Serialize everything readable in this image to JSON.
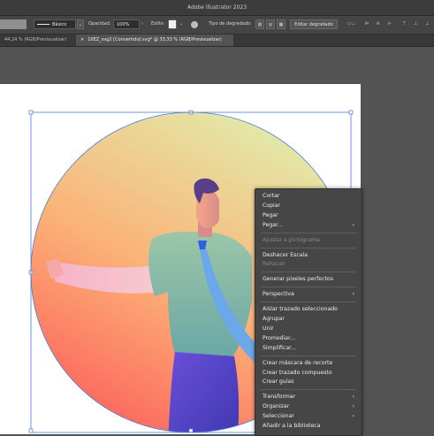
{
  "app": {
    "title": "Adobe Illustrator 2023"
  },
  "control_bar": {
    "stroke_style": "Básico",
    "opacity_label": "Opacidad:",
    "opacity_value": "100%",
    "style_label": "Estilo:",
    "gradient_type_label": "Tipo de degradado:",
    "edit_gradient_button": "Editar degradado"
  },
  "tabs": [
    {
      "label": "44,24 % (RGB/Previsualizar)"
    },
    {
      "label": "10EZ_svg2 [Convertido].svg* @ 33,33 % (RGB/Previsualizar)"
    }
  ],
  "colors": {
    "selection": "#4a7bd8",
    "menu_bg": "#464646",
    "canvas_bg": "#535353"
  },
  "context_menu": {
    "groups": [
      [
        {
          "label": "Cortar",
          "enabled": true,
          "submenu": false
        },
        {
          "label": "Copiar",
          "enabled": true,
          "submenu": false
        },
        {
          "label": "Pegar",
          "enabled": true,
          "submenu": false
        },
        {
          "label": "Pegar...",
          "enabled": true,
          "submenu": true
        }
      ],
      [
        {
          "label": "Ajustar a pictograma",
          "enabled": false,
          "submenu": false
        }
      ],
      [
        {
          "label": "Deshacer Escala",
          "enabled": true,
          "submenu": false
        },
        {
          "label": "Rehacer",
          "enabled": false,
          "submenu": false
        }
      ],
      [
        {
          "label": "Generar píxeles perfectos",
          "enabled": true,
          "submenu": false
        }
      ],
      [
        {
          "label": "Perspectiva",
          "enabled": true,
          "submenu": true
        }
      ],
      [
        {
          "label": "Aislar trazado seleccionado",
          "enabled": true,
          "submenu": false
        },
        {
          "label": "Agrupar",
          "enabled": true,
          "submenu": false
        },
        {
          "label": "Unir",
          "enabled": true,
          "submenu": false
        },
        {
          "label": "Promediar...",
          "enabled": true,
          "submenu": false
        },
        {
          "label": "Simplificar...",
          "enabled": true,
          "submenu": false
        }
      ],
      [
        {
          "label": "Crear máscara de recorte",
          "enabled": true,
          "submenu": false
        },
        {
          "label": "Crear trazado compuesto",
          "enabled": true,
          "submenu": false
        },
        {
          "label": "Crear guías",
          "enabled": true,
          "submenu": false
        }
      ],
      [
        {
          "label": "Transformar",
          "enabled": true,
          "submenu": true
        },
        {
          "label": "Organizar",
          "enabled": true,
          "submenu": true
        },
        {
          "label": "Seleccionar",
          "enabled": true,
          "submenu": true
        },
        {
          "label": "Añadir a la biblioteca",
          "enabled": true,
          "submenu": false
        }
      ]
    ]
  }
}
